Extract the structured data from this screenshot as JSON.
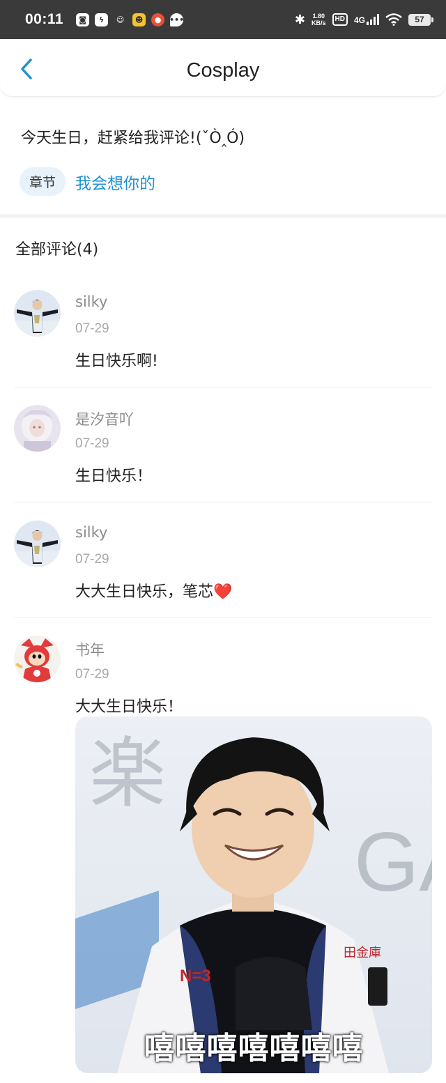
{
  "status_bar": {
    "time": "00:11",
    "speed_value": "1.80",
    "speed_unit": "KB/s",
    "hd": "HD",
    "network": "4G",
    "battery": "57"
  },
  "header": {
    "title": "Cosplay"
  },
  "post": {
    "text": "今天生日，赶紧给我评论!(ˇÒ‸Ó)",
    "chapter_tag": "章节",
    "chapter_link": "我会想你的"
  },
  "comments_header": "全部评论(4)",
  "comments": [
    {
      "user": "silky",
      "date": "07-29",
      "text": "生日快乐啊!"
    },
    {
      "user": "是汐音吖",
      "date": "07-29",
      "text": "生日快乐！"
    },
    {
      "user": "silky",
      "date": "07-29",
      "text": "大大生日快乐，笔芯❤️"
    },
    {
      "user": "书年",
      "date": "07-29",
      "text": "大大生日快乐！"
    }
  ],
  "image_caption": "嘻嘻嘻嘻嘻嘻嘻",
  "colors": {
    "accent": "#1e90d6",
    "status_bar_bg": "#3a3a3a",
    "chapter_tag_bg": "#e7f2fb"
  }
}
